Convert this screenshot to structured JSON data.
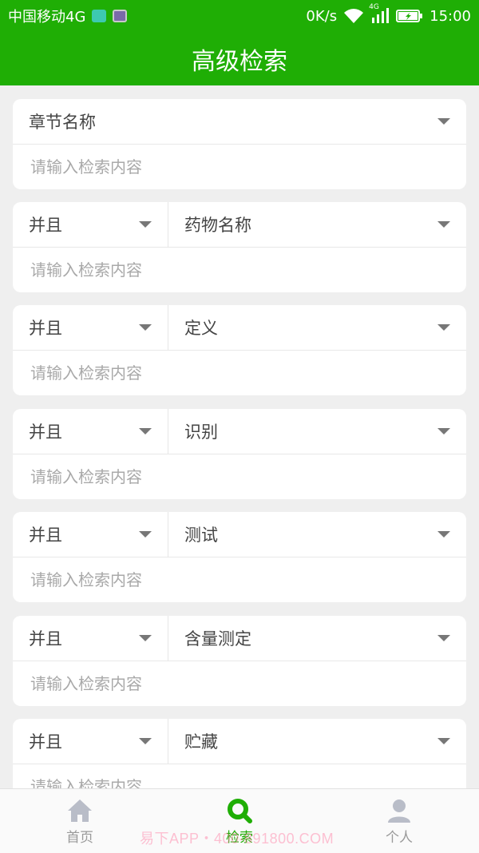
{
  "status_bar": {
    "carrier": "中国移动4G",
    "speed": "0K/s",
    "network_badge": "4G",
    "time": "15:00"
  },
  "app_bar": {
    "title": "高级检索"
  },
  "criteria": [
    {
      "logic": "",
      "field": "章节名称",
      "placeholder": "请输入检索内容"
    },
    {
      "logic": "并且",
      "field": "药物名称",
      "placeholder": "请输入检索内容"
    },
    {
      "logic": "并且",
      "field": "定义",
      "placeholder": "请输入检索内容"
    },
    {
      "logic": "并且",
      "field": "识别",
      "placeholder": "请输入检索内容"
    },
    {
      "logic": "并且",
      "field": "测试",
      "placeholder": "请输入检索内容"
    },
    {
      "logic": "并且",
      "field": "含量测定",
      "placeholder": "请输入检索内容"
    },
    {
      "logic": "并且",
      "field": "贮藏",
      "placeholder": "请输入检索内容"
    }
  ],
  "tab_bar": {
    "items": [
      {
        "label": "首页",
        "icon": "home-icon",
        "active": false
      },
      {
        "label": "检索",
        "icon": "search-icon",
        "active": true
      },
      {
        "label": "个人",
        "icon": "person-icon",
        "active": false
      }
    ]
  },
  "watermark": "易下APP・400-891800.COM",
  "colors": {
    "brand": "#1fae05",
    "background": "#efefef"
  }
}
